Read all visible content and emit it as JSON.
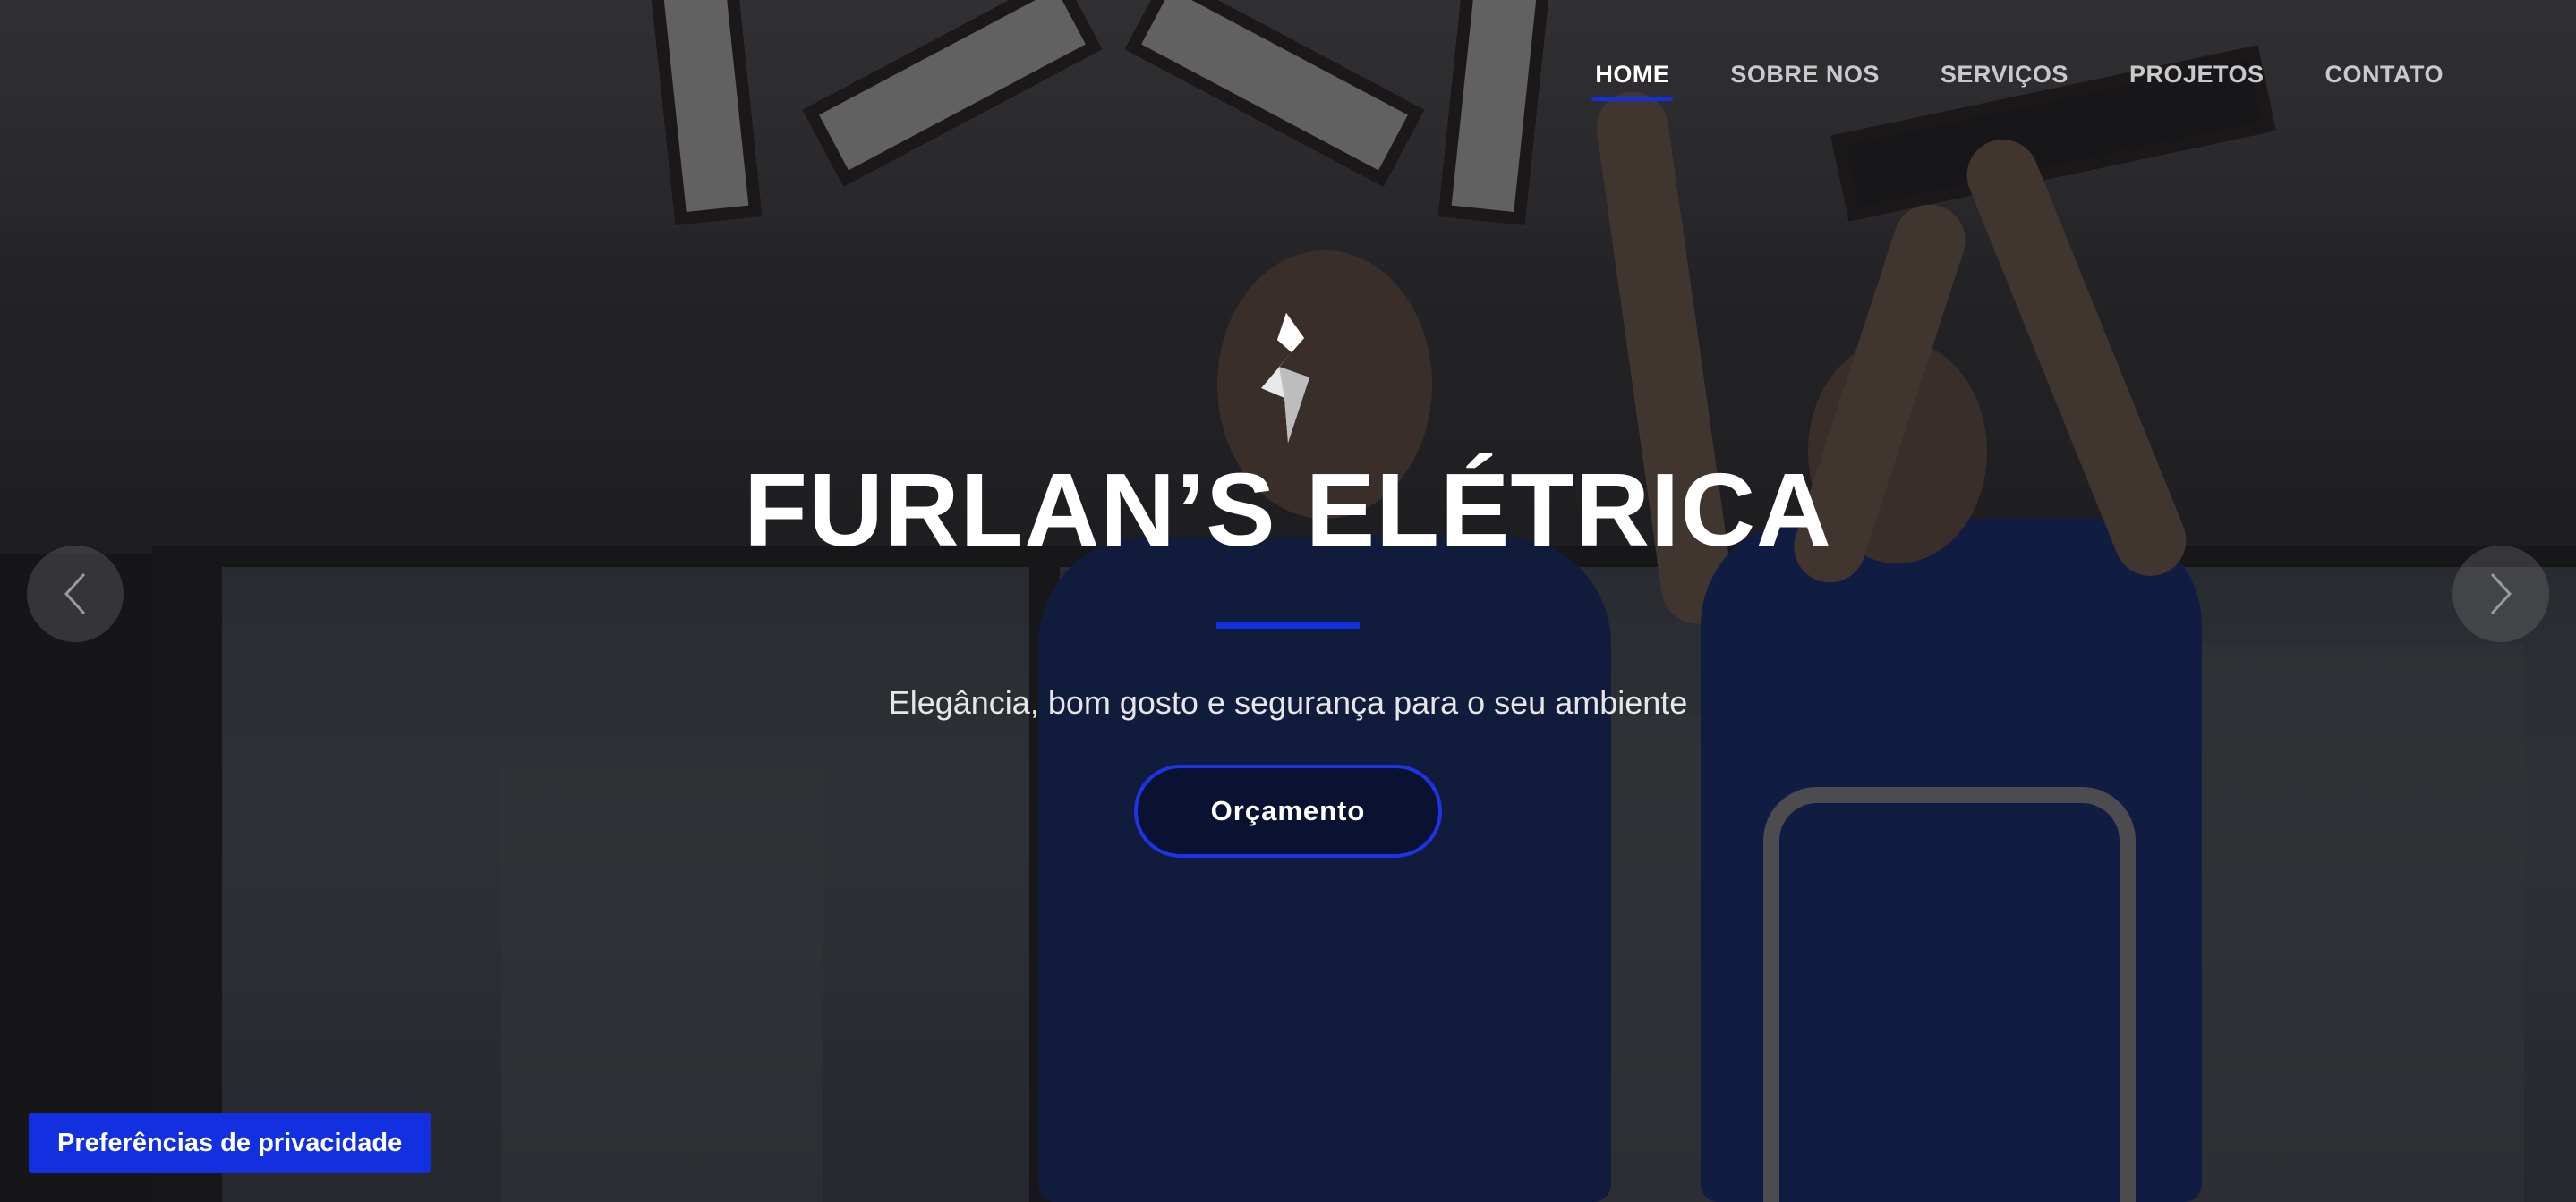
{
  "nav": {
    "items": [
      {
        "label": "HOME",
        "active": true
      },
      {
        "label": "SOBRE NOS",
        "active": false
      },
      {
        "label": "SERVIÇOS",
        "active": false
      },
      {
        "label": "PROJETOS",
        "active": false
      },
      {
        "label": "CONTATO",
        "active": false
      }
    ]
  },
  "hero": {
    "logo_icon": "lightning-bolt-icon",
    "title": "FURLAN’S ELÉTRICA",
    "subtitle": "Elegância, bom gosto e segurança para o seu ambiente",
    "cta_label": "Orçamento",
    "prev_icon": "chevron-left-icon",
    "next_icon": "chevron-right-icon"
  },
  "privacy": {
    "label": "Preferências de privacidade"
  },
  "colors": {
    "accent": "#1230e0",
    "text": "#ffffff",
    "nav_inactive": "#c9c9c9"
  }
}
